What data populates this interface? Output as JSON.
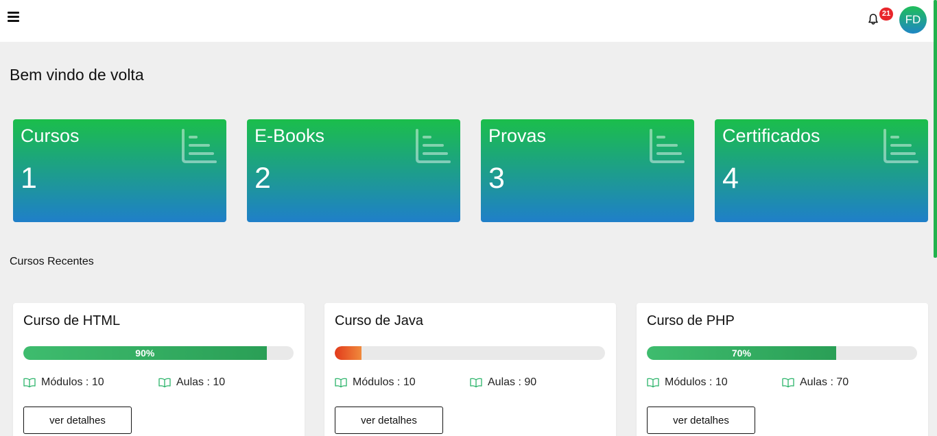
{
  "header": {
    "notifications_count": "21",
    "user_initials": "FD"
  },
  "page": {
    "title": "Bem vindo de volta",
    "recent_section_title": "Cursos Recentes"
  },
  "stats": [
    {
      "label": "Cursos",
      "value": "1"
    },
    {
      "label": "E-Books",
      "value": "2"
    },
    {
      "label": "Provas",
      "value": "3"
    },
    {
      "label": "Certificados",
      "value": "4"
    }
  ],
  "courses": [
    {
      "title": "Curso de HTML",
      "progress": 90,
      "progress_label": "90%",
      "bar_color": "green",
      "modules": "Módulos : 10",
      "lessons": "Aulas : 10",
      "button": "ver detalhes"
    },
    {
      "title": "Curso de Java",
      "progress": 10,
      "progress_label": "",
      "bar_color": "red",
      "modules": "Módulos : 10",
      "lessons": "Aulas : 90",
      "button": "ver detalhes"
    },
    {
      "title": "Curso de PHP",
      "progress": 70,
      "progress_label": "70%",
      "bar_color": "green",
      "modules": "Módulos : 10",
      "lessons": "Aulas : 70",
      "button": "ver detalhes"
    }
  ],
  "icons": {
    "menu": "hamburger-menu-icon",
    "bell": "bell-icon",
    "stat": "chart-list-icon",
    "book": "open-book-icon"
  },
  "colors": {
    "accent_green": "#1bbe4b",
    "accent_blue": "#1f7fc9",
    "badge_red": "#e8262b",
    "progress_red": "#e23a1b"
  }
}
